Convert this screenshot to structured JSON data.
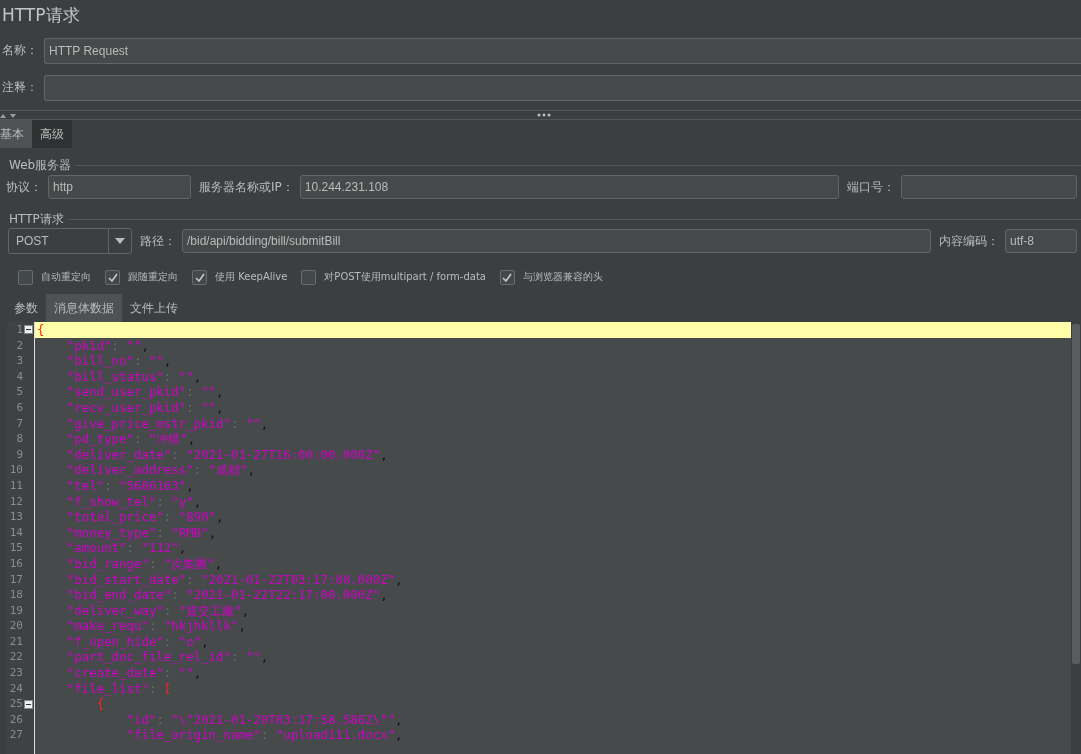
{
  "title": "HTTP请求",
  "name_field": {
    "label": "名称：",
    "value": "HTTP Request"
  },
  "comment_field": {
    "label": "注释："
  },
  "tabs": [
    {
      "label": "基本",
      "selected": true
    },
    {
      "label": "高级",
      "selected": false
    }
  ],
  "web_server": {
    "legend": "Web服务器",
    "protocol": {
      "label": "协议：",
      "value": "http"
    },
    "server": {
      "label": "服务器名称或IP：",
      "value": "10.244.231.108"
    },
    "port": {
      "label": "端口号："
    }
  },
  "http_request": {
    "legend": "HTTP请求",
    "method": "POST",
    "path": {
      "label": "路径：",
      "value": "/bid/api/bidding/bill/submitBill"
    },
    "encoding": {
      "label": "内容编码：",
      "value": "utf-8"
    }
  },
  "options": [
    {
      "label": "自动重定向",
      "checked": false
    },
    {
      "label": "跟随重定向",
      "checked": true
    },
    {
      "label": "使用 KeepAlive",
      "checked": true
    },
    {
      "label": "对POST使用multipart / form-data",
      "checked": false
    },
    {
      "label": "与浏览器兼容的头",
      "checked": true
    }
  ],
  "sub_tabs": [
    {
      "label": "参数",
      "selected": false
    },
    {
      "label": "消息体数据",
      "selected": true
    },
    {
      "label": "文件上传",
      "selected": false
    }
  ],
  "code_lines": [
    {
      "number": "1",
      "text": "{",
      "current": true,
      "foldable": true
    },
    {
      "number": "2",
      "text": "    \"pkid\": \"\",",
      "current": false,
      "foldable": false
    },
    {
      "number": "3",
      "text": "    \"bill_no\": \"\",",
      "current": false,
      "foldable": false
    },
    {
      "number": "4",
      "text": "    \"bill_status\": \"\",",
      "current": false,
      "foldable": false
    },
    {
      "number": "5",
      "text": "    \"send_user_pkid\": \"\",",
      "current": false,
      "foldable": false
    },
    {
      "number": "6",
      "text": "    \"recv_user_pkid\": \"\",",
      "current": false,
      "foldable": false
    },
    {
      "number": "7",
      "text": "    \"give_price_mstr_pkid\": \"\",",
      "current": false,
      "foldable": false
    },
    {
      "number": "8",
      "text": "    \"pd_type\": \"冲模\",",
      "current": false,
      "foldable": false
    },
    {
      "number": "9",
      "text": "    \"deliver_date\": \"2021-01-27T16:00:00.000Z\",",
      "current": false,
      "foldable": false
    },
    {
      "number": "10",
      "text": "    \"deliver_address\": \"成都\",",
      "current": false,
      "foldable": false
    },
    {
      "number": "11",
      "text": "    \"tel\": \"5686163\",",
      "current": false,
      "foldable": false
    },
    {
      "number": "12",
      "text": "    \"f_show_tel\": \"y\",",
      "current": false,
      "foldable": false
    },
    {
      "number": "13",
      "text": "    \"total_price\": \"890\",",
      "current": false,
      "foldable": false
    },
    {
      "number": "14",
      "text": "    \"money_type\": \"RMB\",",
      "current": false,
      "foldable": false
    },
    {
      "number": "15",
      "text": "    \"amount\": \"112\",",
      "current": false,
      "foldable": false
    },
    {
      "number": "16",
      "text": "    \"bid_range\": \"次集團\",",
      "current": false,
      "foldable": false
    },
    {
      "number": "17",
      "text": "    \"bid_start_date\": \"2021-01-22T03:17:00.000Z\",",
      "current": false,
      "foldable": false
    },
    {
      "number": "18",
      "text": "    \"bid_end_date\": \"2021-01-22T22:17:00.000Z\",",
      "current": false,
      "foldable": false
    },
    {
      "number": "19",
      "text": "    \"deliver_way\": \"貨交工廠\",",
      "current": false,
      "foldable": false
    },
    {
      "number": "20",
      "text": "    \"make_requ\": \"hkjhkllk\",",
      "current": false,
      "foldable": false
    },
    {
      "number": "21",
      "text": "    \"f_open_hide\": \"o\",",
      "current": false,
      "foldable": false
    },
    {
      "number": "22",
      "text": "    \"part_doc_file_rel_id\": \"\",",
      "current": false,
      "foldable": false
    },
    {
      "number": "23",
      "text": "    \"create_date\": \"\",",
      "current": false,
      "foldable": false
    },
    {
      "number": "24",
      "text": "    \"file_list\": [",
      "current": false,
      "foldable": false
    },
    {
      "number": "25",
      "text": "        {",
      "current": false,
      "foldable": true
    },
    {
      "number": "26",
      "text": "            \"id\": \"\\\"2021-01-20T03:17:58.586Z\\\"\",",
      "current": false,
      "foldable": false
    },
    {
      "number": "27",
      "text": "            \"file_origin_name\": \"upload111.docx\",",
      "current": false,
      "foldable": false
    }
  ]
}
